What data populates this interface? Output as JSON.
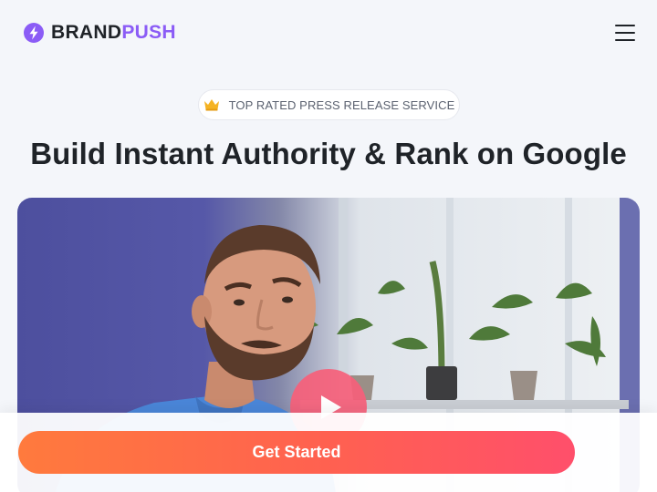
{
  "header": {
    "brand_part1": "BRAND",
    "brand_part2": "PUSH",
    "logo_icon": "lightning-bolt-icon",
    "menu_icon": "hamburger-menu-icon"
  },
  "hero": {
    "badge_icon": "crown-icon",
    "badge_text": "TOP RATED PRESS RELEASE SERVICE",
    "headline": "Build Instant Authority & Rank on Google"
  },
  "video": {
    "play_icon": "play-icon"
  },
  "cta": {
    "label": "Get Started"
  },
  "colors": {
    "brand_purple": "#8b5cf6",
    "cta_start": "#ff7a3d",
    "cta_end": "#ff4f6b",
    "play_button": "#f66079",
    "page_background": "#f4f6fa"
  }
}
